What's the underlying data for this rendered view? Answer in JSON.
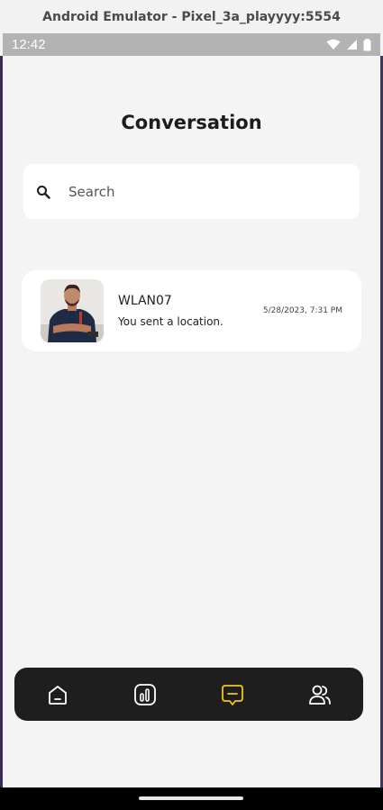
{
  "window": {
    "title": "Android Emulator - Pixel_3a_playyyy:5554"
  },
  "status_bar": {
    "time": "12:42",
    "icons": [
      "wifi-icon",
      "signal-icon",
      "battery-icon"
    ]
  },
  "page": {
    "title": "Conversation"
  },
  "search": {
    "placeholder": "Search",
    "icon": "search-icon"
  },
  "conversations": [
    {
      "name": "WLAN07",
      "last_message": "You sent a location.",
      "timestamp": "5/28/2023, 7:31 PM",
      "avatar": "person-photo"
    }
  ],
  "bottom_nav": {
    "items": [
      {
        "id": "home",
        "icon": "home-icon",
        "active": false
      },
      {
        "id": "stats",
        "icon": "chart-icon",
        "active": false
      },
      {
        "id": "messages",
        "icon": "chat-icon",
        "active": true
      },
      {
        "id": "contacts",
        "icon": "users-icon",
        "active": false
      }
    ],
    "active_color": "#f5c518",
    "inactive_color": "#ffffff"
  }
}
